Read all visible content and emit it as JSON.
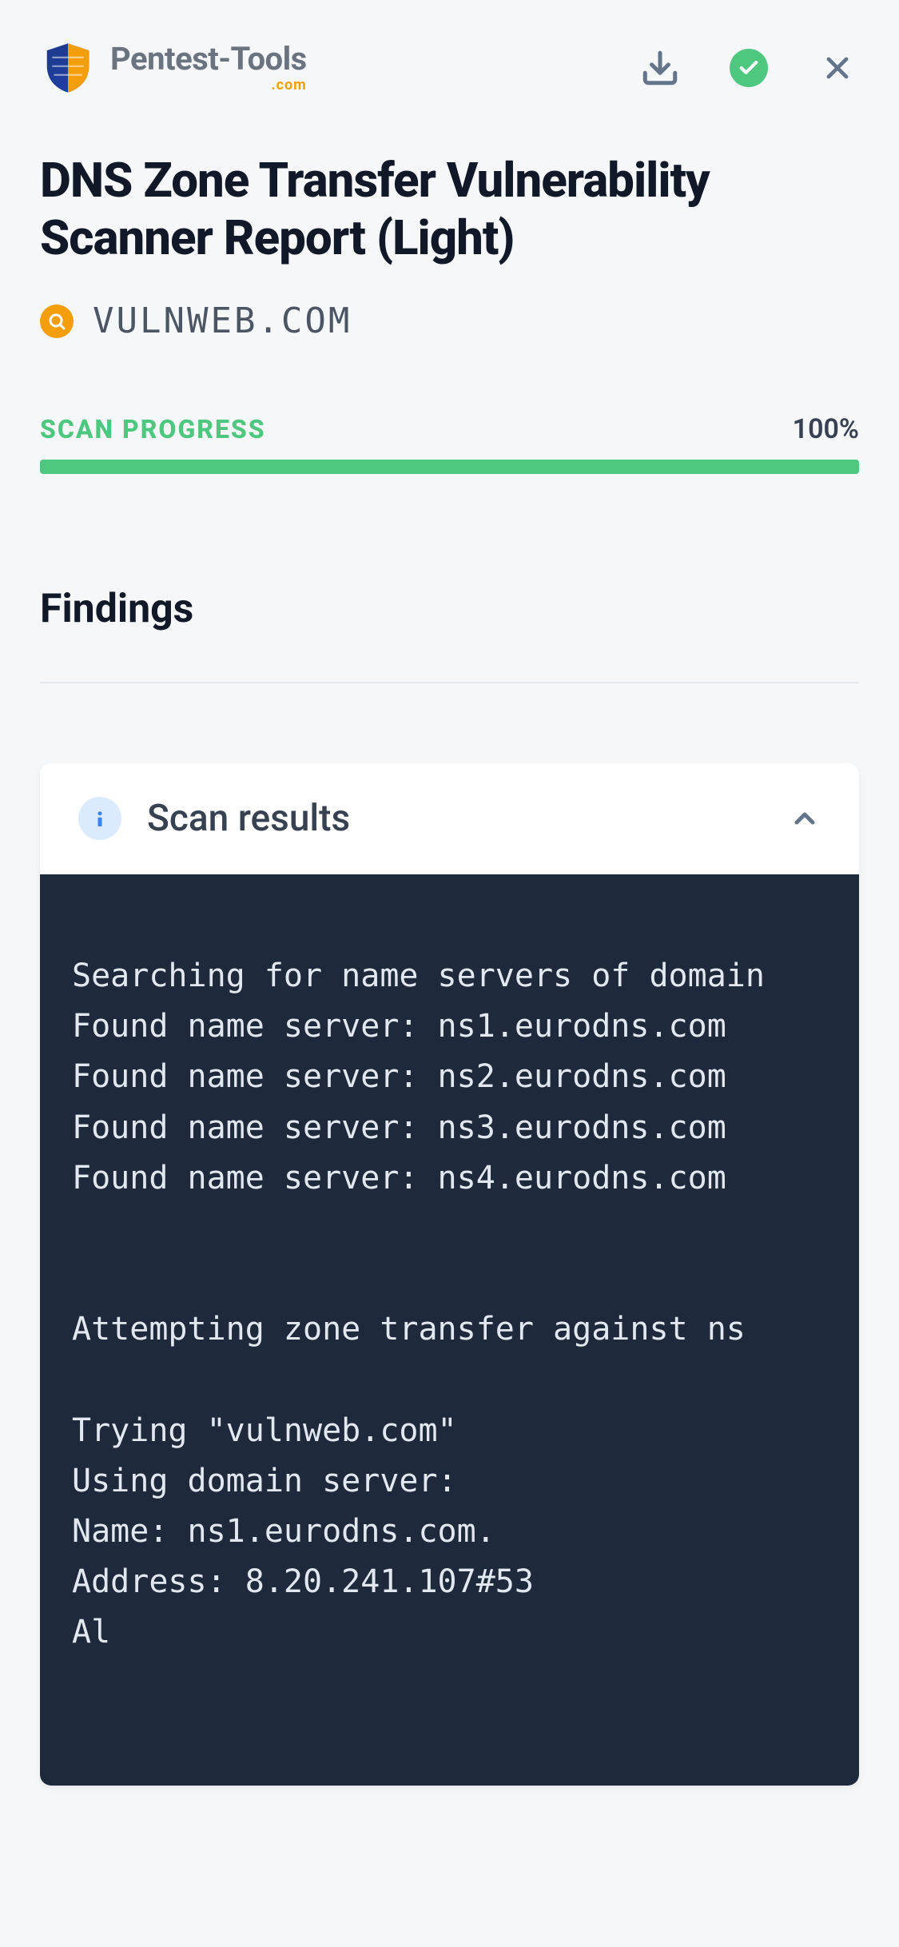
{
  "brand": {
    "name": "Pentest-Tools",
    "suffix": ".com"
  },
  "header": {
    "title": "DNS Zone Transfer Vulnerability Scanner Report (Light)"
  },
  "target": {
    "host": "VULNWEB.COM"
  },
  "progress": {
    "label": "SCAN PROGRESS",
    "percent_text": "100%",
    "percent_value": 100
  },
  "sections": {
    "findings_title": "Findings"
  },
  "findings_card": {
    "title": "Scan results",
    "terminal_output": "Searching for name servers of domain\nFound name server: ns1.eurodns.com\nFound name server: ns2.eurodns.com\nFound name server: ns3.eurodns.com\nFound name server: ns4.eurodns.com\n\n\nAttempting zone transfer against ns\n\nTrying \"vulnweb.com\"\nUsing domain server:\nName: ns1.eurodns.com.\nAddress: 8.20.241.107#53\nAl"
  },
  "colors": {
    "accent_green": "#4ec77f",
    "accent_amber": "#f59e0b",
    "info_blue": "#3b82f6"
  }
}
